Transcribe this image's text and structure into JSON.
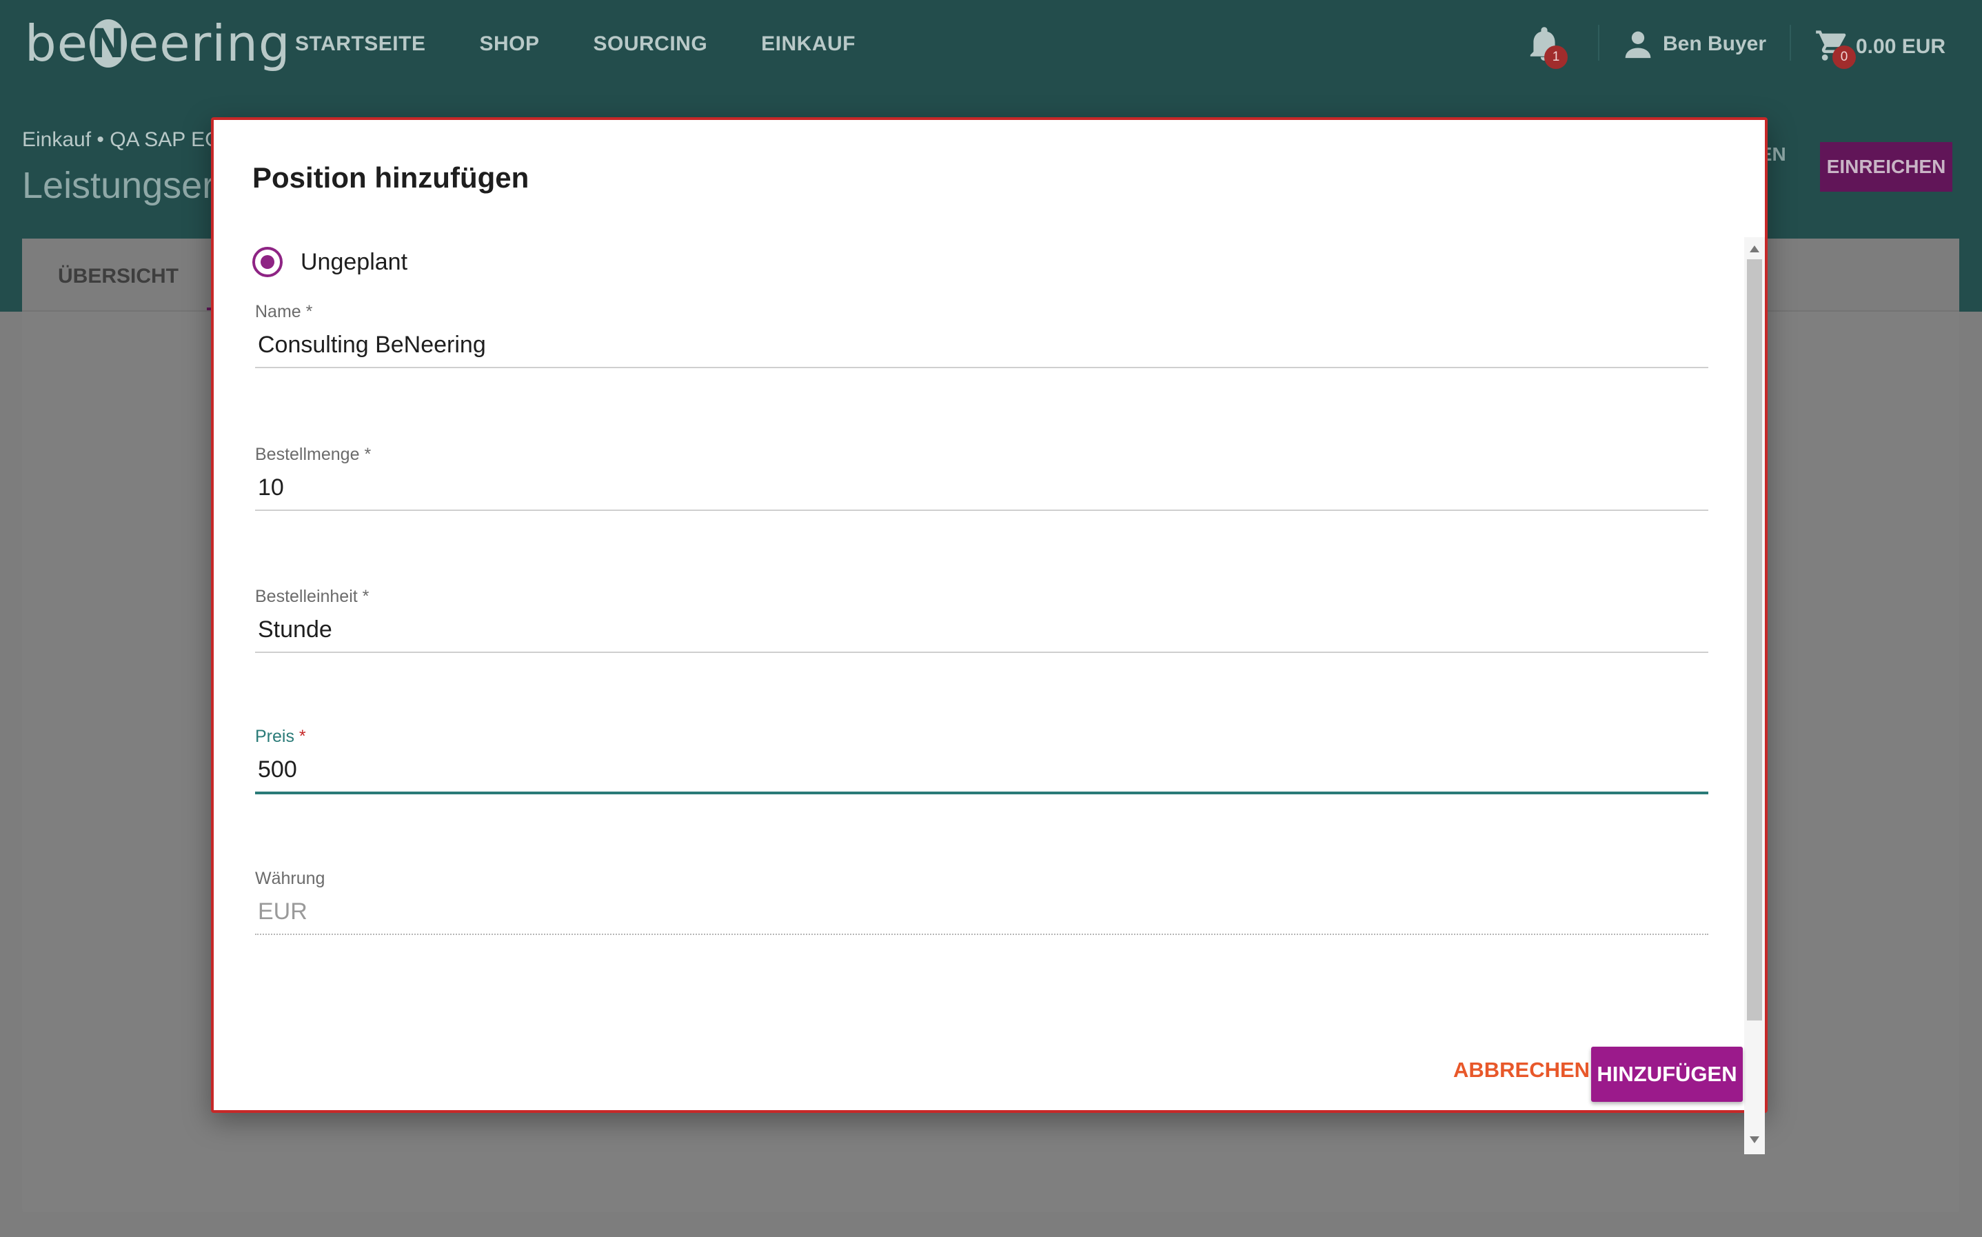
{
  "app": {
    "logo_text_left": "be",
    "logo_text_mark": "N",
    "logo_text_right": "eering",
    "nav": [
      "STARTSEITE",
      "SHOP",
      "SOURCING",
      "EINKAUF"
    ],
    "notifications_count": "1",
    "user_name": "Ben Buyer",
    "cart_count": "0",
    "cart_total": "0.00 EUR"
  },
  "page": {
    "breadcrumb": "Einkauf • QA SAP EC",
    "title": "Leistungser",
    "header_action_partial": "GEN",
    "header_submit": "EINREICHEN",
    "tab_overview": "ÜBERSICHT"
  },
  "dialog": {
    "title": "Position hinzufügen",
    "radio_label": "Ungeplant",
    "fields": {
      "name": {
        "label": "Name",
        "required": "*",
        "value": "Consulting BeNeering"
      },
      "quantity": {
        "label": "Bestellmenge",
        "required": "*",
        "value": "10"
      },
      "unit": {
        "label": "Bestelleinheit",
        "required": "*",
        "value": "Stunde"
      },
      "price": {
        "label": "Preis",
        "required": "*",
        "value": "500"
      },
      "currency": {
        "label": "Währung",
        "value": "EUR"
      }
    },
    "cancel_label": "ABBRECHEN",
    "add_label": "HINZUFÜGEN"
  },
  "colors": {
    "topbar": "#234d4c",
    "accent_purple": "#9b1a8b",
    "focus_teal": "#2a7b78",
    "cancel_orange": "#e8582a",
    "badge_red": "#a12c2c"
  },
  "icons": [
    "bell-icon",
    "person-icon",
    "cart-icon"
  ]
}
